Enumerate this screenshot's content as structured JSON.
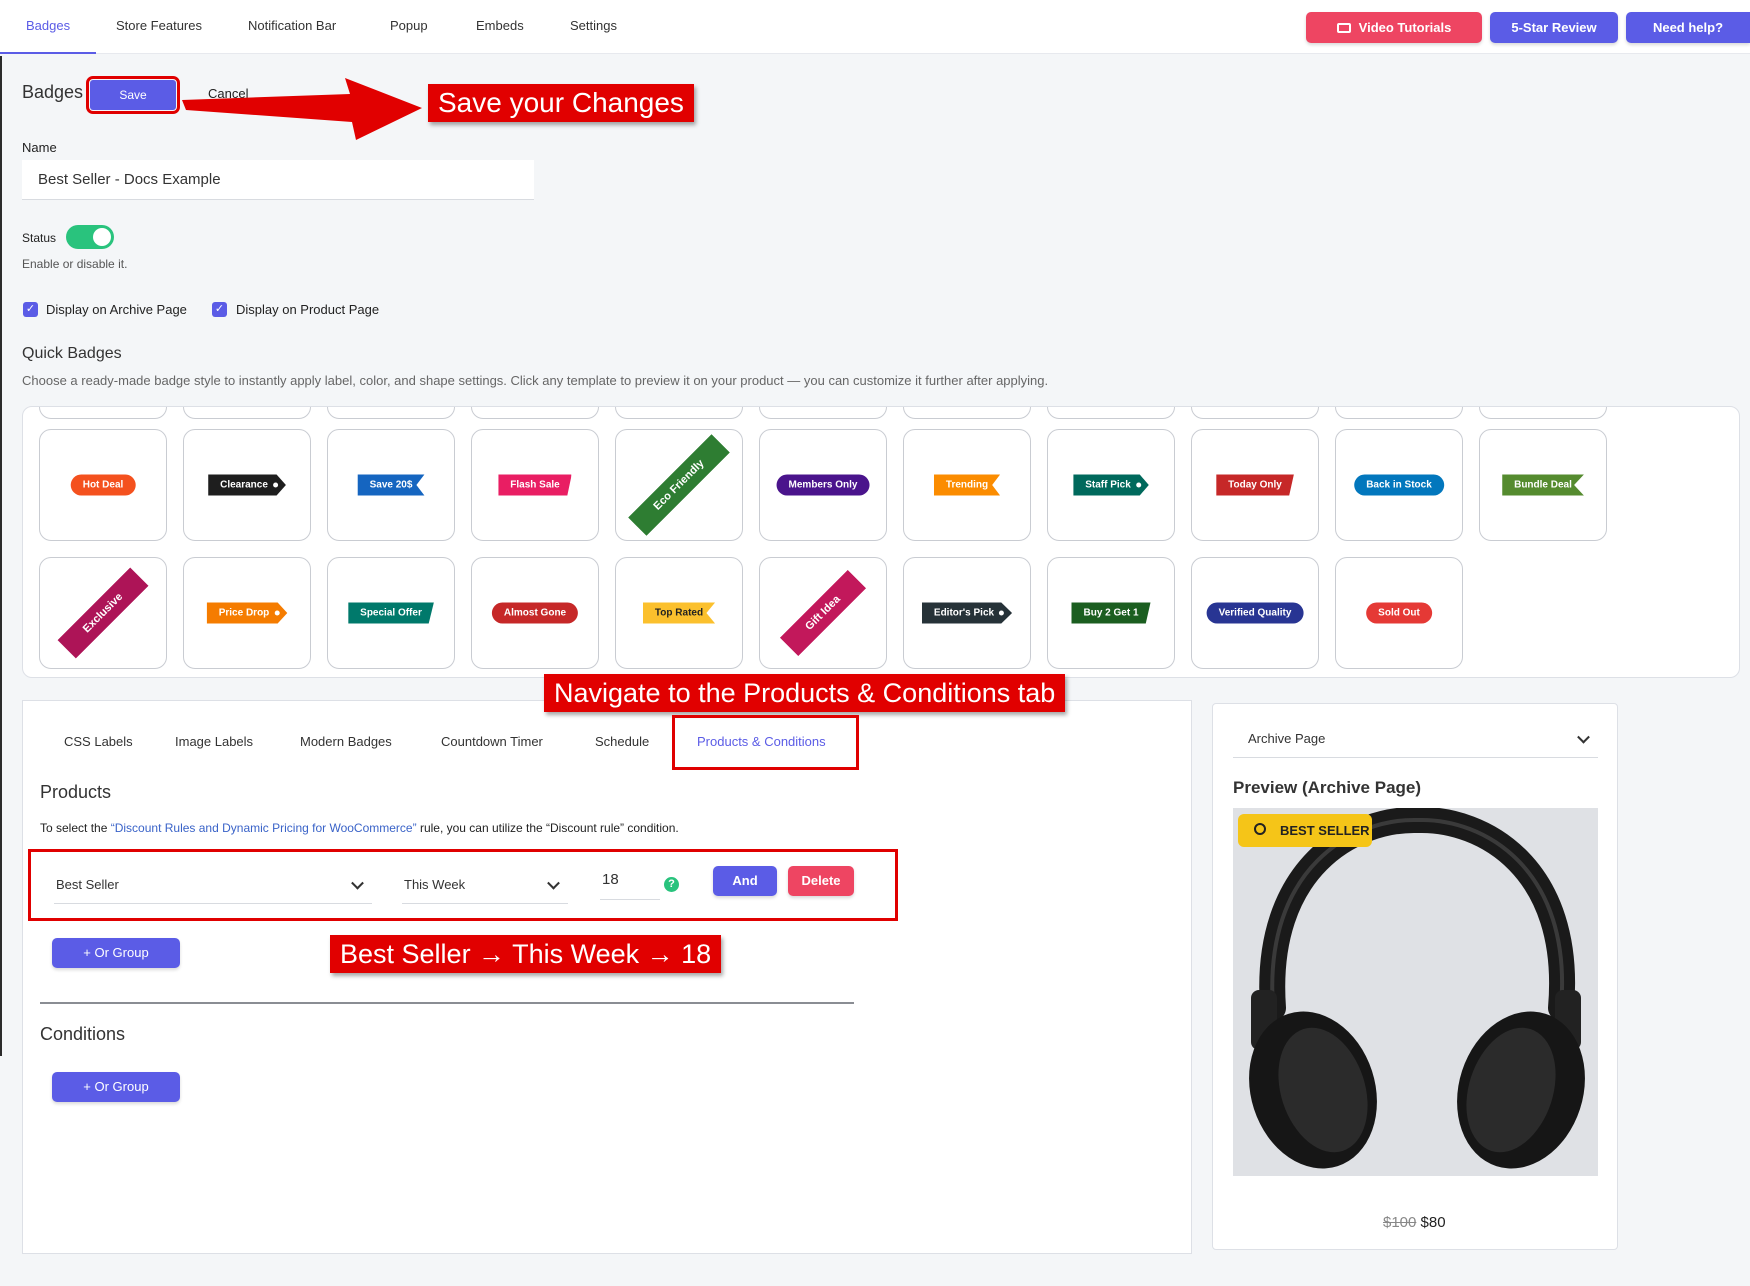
{
  "topnav": {
    "tabs": [
      "Badges",
      "Store Features",
      "Notification Bar",
      "Popup",
      "Embeds",
      "Settings"
    ],
    "video_tutorials": "Video Tutorials",
    "review": "5-Star Review",
    "help": "Need help?"
  },
  "header": {
    "title": "Badges",
    "save": "Save",
    "cancel": "Cancel"
  },
  "callouts": {
    "save": "Save your Changes",
    "navigate": "Navigate to the Products & Conditions tab",
    "rule": "Best Seller → This Week → 18"
  },
  "form": {
    "name_label": "Name",
    "name_value": "Best Seller - Docs Example",
    "status_label": "Status",
    "status_help": "Enable or disable it.",
    "archive_cb": "Display on Archive Page",
    "product_cb": "Display on Product Page"
  },
  "quick": {
    "title": "Quick Badges",
    "desc": "Choose a ready-made badge style to instantly apply label, color, and shape settings. Click any template to preview it on your product — you can customize it further after applying.",
    "row1": [
      "Hot Deal",
      "Clearance",
      "Save 20$",
      "Flash Sale",
      "Eco Friendly",
      "Members Only",
      "Trending",
      "Staff Pick",
      "Today Only",
      "Back in Stock",
      "Bundle Deal"
    ],
    "row2": [
      "Exclusive",
      "Price Drop",
      "Special Offer",
      "Almost Gone",
      "Top Rated",
      "Gift Idea",
      "Editor's Pick",
      "Buy 2 Get 1",
      "Verified Quality",
      "Sold Out"
    ],
    "colors": {
      "Hot Deal": "#f4511e",
      "Clearance": "#1e1e1e",
      "Save 20$": "#1565c0",
      "Flash Sale": "#e91e63",
      "Eco Friendly": "#2e7d32",
      "Members Only": "#4a148c",
      "Trending": "#fb8c00",
      "Staff Pick": "#00695c",
      "Today Only": "#c62828",
      "Back in Stock": "#0277bd",
      "Bundle Deal": "#558b2f",
      "Exclusive": "#ad1457",
      "Price Drop": "#f57c00",
      "Special Offer": "#00796b",
      "Almost Gone": "#c62828",
      "Top Rated": "#fbc02d",
      "Gift Idea": "#c2185b",
      "Editor's Pick": "#263238",
      "Buy 2 Get 1": "#1b5e20",
      "Verified Quality": "#283593",
      "Sold Out": "#e53935"
    }
  },
  "subtabs": [
    "CSS Labels",
    "Image Labels",
    "Modern Badges",
    "Countdown Timer",
    "Schedule",
    "Products & Conditions"
  ],
  "products": {
    "title": "Products",
    "note_pre": "To select the ",
    "note_link": "“Discount Rules and Dynamic Pricing for WooCommerce”",
    "note_post": " rule, you can utilize the “Discount rule” condition.",
    "rule_type": "Best Seller",
    "rule_period": "This Week",
    "rule_count": "18",
    "and": "And",
    "delete": "Delete",
    "or_group": "+ Or Group"
  },
  "conditions": {
    "title": "Conditions",
    "or_group": "+ Or Group"
  },
  "preview": {
    "select": "Archive Page",
    "title": "Preview (Archive Page)",
    "badge": "BEST SELLER",
    "old_price": "$100",
    "new_price": "$80"
  }
}
